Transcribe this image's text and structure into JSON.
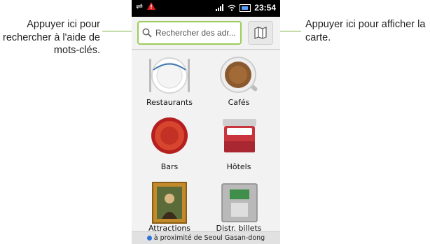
{
  "callouts": {
    "search": "Appuyer ici pour rechercher à l'aide de mots-clés.",
    "map": "Appuyer ici pour afficher la carte."
  },
  "statusbar": {
    "time": "23:54"
  },
  "search": {
    "placeholder": "Rechercher des adr..."
  },
  "categories": [
    {
      "label": "Restaurants",
      "icon": "plate-icon"
    },
    {
      "label": "Cafés",
      "icon": "coffee-cup-icon"
    },
    {
      "label": "Bars",
      "icon": "bottle-cap-icon"
    },
    {
      "label": "Hôtels",
      "icon": "bed-icon"
    },
    {
      "label": "Attractions",
      "icon": "painting-icon"
    },
    {
      "label": "Distr. billets",
      "icon": "atm-icon"
    }
  ],
  "footer": {
    "location": "à proximité de Seoul Gasan-dong"
  },
  "colors": {
    "accent": "#9ccc5a",
    "statusbar": "#000000",
    "alert": "#e02020"
  }
}
